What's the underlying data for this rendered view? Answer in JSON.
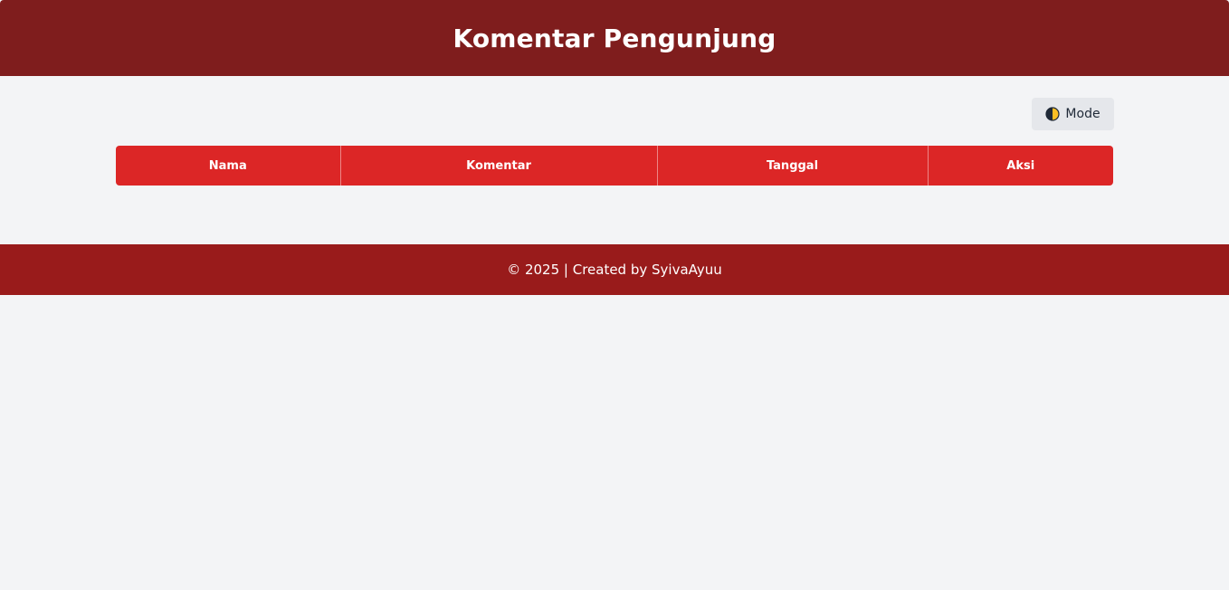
{
  "header": {
    "title": "Komentar Pengunjung"
  },
  "toolbar": {
    "mode_icon": "half-moon-icon",
    "mode_label": "Mode"
  },
  "table": {
    "columns": [
      "Nama",
      "Komentar",
      "Tanggal",
      "Aksi"
    ],
    "rows": []
  },
  "footer": {
    "text": "© 2025 | Created by SyivaAyuu"
  },
  "colors": {
    "header_bg": "#7f1d1d",
    "table_header_bg": "#dc2626",
    "footer_bg": "#991b1b",
    "page_bg": "#f3f4f6",
    "mode_button_bg": "#e5e7eb"
  }
}
